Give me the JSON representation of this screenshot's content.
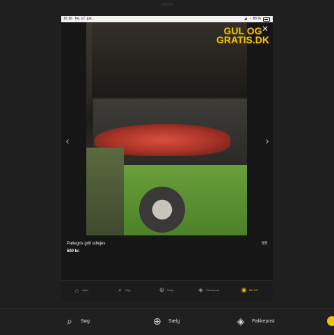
{
  "statusbar": {
    "time": "15.10",
    "date": "fre. 17. jun.",
    "battery": "85 %"
  },
  "listing": {
    "title": "Pattegris grill udlejes",
    "price": "500 kr.",
    "counter": "5/5"
  },
  "logo": {
    "line1": "GUL OG",
    "line2": "GRATIS.DK"
  },
  "close_label": "×",
  "prev_label": "‹",
  "next_label": "›",
  "inner_nav": [
    {
      "label": "Hjem",
      "icon": "home-icon"
    },
    {
      "label": "Søg",
      "icon": "search-icon"
    },
    {
      "label": "Sælg",
      "icon": "plus-circle-icon"
    },
    {
      "label": "Pakkepost",
      "icon": "package-icon"
    },
    {
      "label": "Mit GG",
      "icon": "user-icon"
    }
  ],
  "bottom_nav": [
    {
      "label": "Søg",
      "icon": "search-icon"
    },
    {
      "label": "Sælg",
      "icon": "plus-circle-icon"
    },
    {
      "label": "Pakkepost",
      "icon": "package-icon"
    }
  ],
  "colors": {
    "accent": "#f2c200",
    "background": "#1f1f1f"
  }
}
